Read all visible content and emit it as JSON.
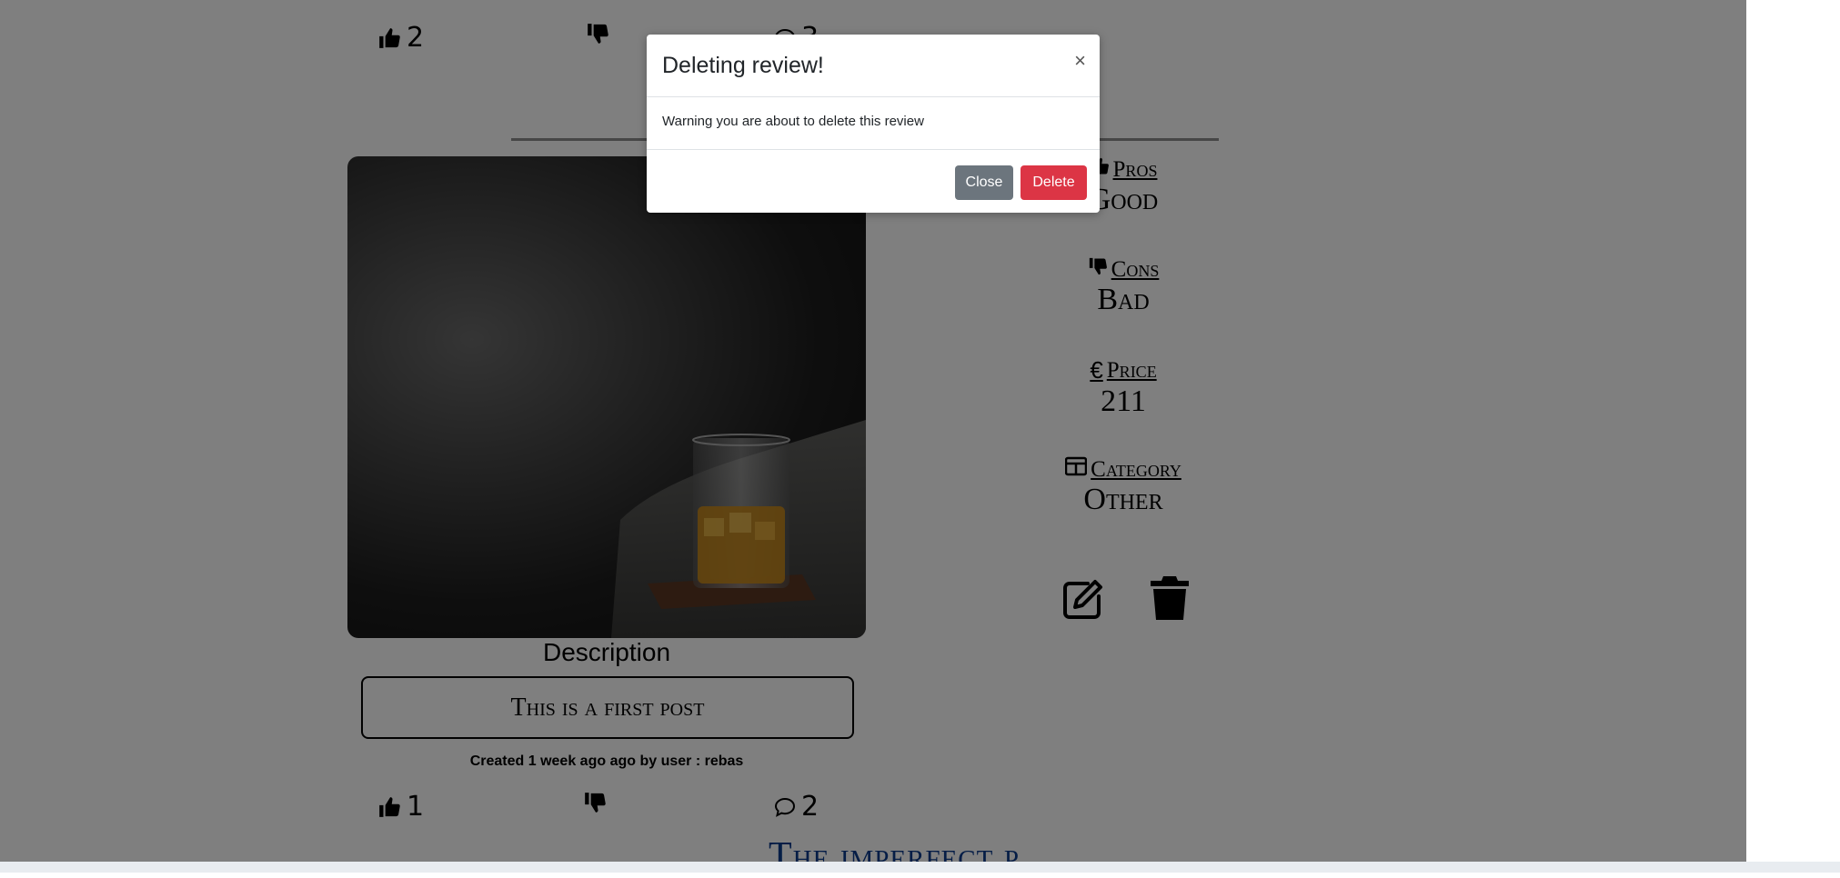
{
  "previous_post": {
    "likes": "2",
    "dislikes": "",
    "comments": "3"
  },
  "post": {
    "image_alt": "whisky glass",
    "description_title": "Description",
    "description": "This is a first post",
    "created": "Created 1 week ago ago by user : rebas",
    "likes": "1",
    "dislikes": "",
    "comments": "2",
    "pros_label": "Pros",
    "pros_value": "Good",
    "cons_label": "Cons",
    "cons_value": "Bad",
    "price_label": "Price",
    "price_symbol": "€",
    "price_value": "211",
    "category_label": "Category",
    "category_value": "Other"
  },
  "next_post_title": "The imperfect p",
  "modal": {
    "title": "Deleting review!",
    "close_symbol": "×",
    "body": "Warning you are about to delete this review",
    "close_button": "Close",
    "delete_button": "Delete"
  },
  "colors": {
    "overlay": "#000000",
    "delete": "#dc3545",
    "close": "#6c757d"
  }
}
